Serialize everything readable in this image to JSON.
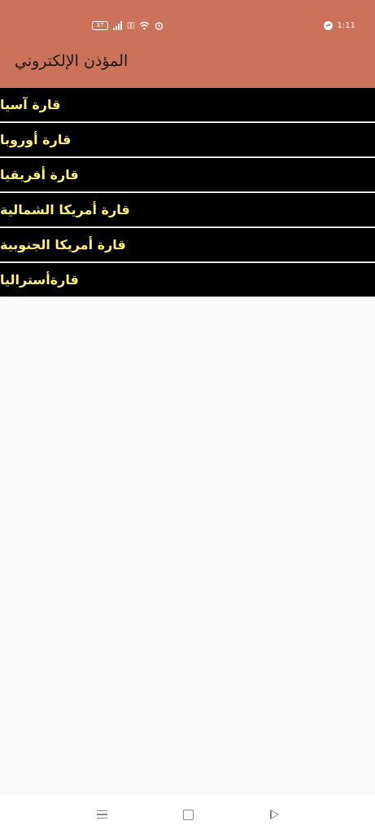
{
  "status_bar": {
    "battery": "37",
    "time": "1:11"
  },
  "app_title": "المؤذن الإلكتروني",
  "continents": [
    "قارة آسيا",
    "قارة أوروبا",
    "قارة أفريقيا",
    "قارة أمريكا الشمالية",
    "قارة أمريكا الجنوبية",
    "قارةأستراليا"
  ],
  "colors": {
    "header_bg": "#cd725a",
    "list_bg": "#000000",
    "list_text": "#fff07a"
  },
  "icons": {
    "battery": "battery-icon",
    "signal": "signal-icon",
    "wifi": "wifi-icon",
    "alarm": "alarm-icon",
    "messenger": "messenger-icon",
    "nav_menu": "menu-icon",
    "nav_home": "home-icon",
    "nav_back": "back-icon"
  }
}
